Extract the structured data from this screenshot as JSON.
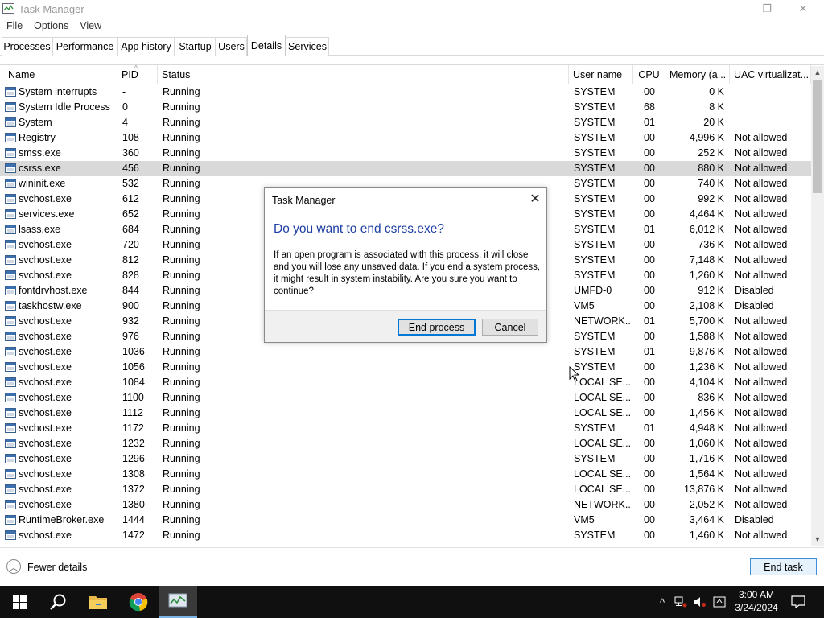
{
  "window": {
    "title": "Task Manager",
    "minimize": "—",
    "restore": "❐",
    "close": "✕"
  },
  "menu": [
    "File",
    "Options",
    "View"
  ],
  "tabs": [
    "Processes",
    "Performance",
    "App history",
    "Startup",
    "Users",
    "Details",
    "Services"
  ],
  "active_tab": "Details",
  "columns": [
    "Name",
    "PID",
    "Status",
    "User name",
    "CPU",
    "Memory (a...",
    "UAC virtualizat..."
  ],
  "rows": [
    {
      "name": "System interrupts",
      "pid": "-",
      "status": "Running",
      "user": "SYSTEM",
      "cpu": "00",
      "mem": "0 K",
      "uac": ""
    },
    {
      "name": "System Idle Process",
      "pid": "0",
      "status": "Running",
      "user": "SYSTEM",
      "cpu": "68",
      "mem": "8 K",
      "uac": ""
    },
    {
      "name": "System",
      "pid": "4",
      "status": "Running",
      "user": "SYSTEM",
      "cpu": "01",
      "mem": "20 K",
      "uac": ""
    },
    {
      "name": "Registry",
      "pid": "108",
      "status": "Running",
      "user": "SYSTEM",
      "cpu": "00",
      "mem": "4,996 K",
      "uac": "Not allowed"
    },
    {
      "name": "smss.exe",
      "pid": "360",
      "status": "Running",
      "user": "SYSTEM",
      "cpu": "00",
      "mem": "252 K",
      "uac": "Not allowed"
    },
    {
      "name": "csrss.exe",
      "pid": "456",
      "status": "Running",
      "user": "SYSTEM",
      "cpu": "00",
      "mem": "880 K",
      "uac": "Not allowed",
      "selected": true
    },
    {
      "name": "wininit.exe",
      "pid": "532",
      "status": "Running",
      "user": "SYSTEM",
      "cpu": "00",
      "mem": "740 K",
      "uac": "Not allowed"
    },
    {
      "name": "svchost.exe",
      "pid": "612",
      "status": "Running",
      "user": "SYSTEM",
      "cpu": "00",
      "mem": "992 K",
      "uac": "Not allowed"
    },
    {
      "name": "services.exe",
      "pid": "652",
      "status": "Running",
      "user": "SYSTEM",
      "cpu": "00",
      "mem": "4,464 K",
      "uac": "Not allowed"
    },
    {
      "name": "lsass.exe",
      "pid": "684",
      "status": "Running",
      "user": "SYSTEM",
      "cpu": "01",
      "mem": "6,012 K",
      "uac": "Not allowed"
    },
    {
      "name": "svchost.exe",
      "pid": "720",
      "status": "Running",
      "user": "SYSTEM",
      "cpu": "00",
      "mem": "736 K",
      "uac": "Not allowed"
    },
    {
      "name": "svchost.exe",
      "pid": "812",
      "status": "Running",
      "user": "SYSTEM",
      "cpu": "00",
      "mem": "7,148 K",
      "uac": "Not allowed"
    },
    {
      "name": "svchost.exe",
      "pid": "828",
      "status": "Running",
      "user": "SYSTEM",
      "cpu": "00",
      "mem": "1,260 K",
      "uac": "Not allowed"
    },
    {
      "name": "fontdrvhost.exe",
      "pid": "844",
      "status": "Running",
      "user": "UMFD-0",
      "cpu": "00",
      "mem": "912 K",
      "uac": "Disabled"
    },
    {
      "name": "taskhostw.exe",
      "pid": "900",
      "status": "Running",
      "user": "VM5",
      "cpu": "00",
      "mem": "2,108 K",
      "uac": "Disabled"
    },
    {
      "name": "svchost.exe",
      "pid": "932",
      "status": "Running",
      "user": "NETWORK...",
      "cpu": "01",
      "mem": "5,700 K",
      "uac": "Not allowed"
    },
    {
      "name": "svchost.exe",
      "pid": "976",
      "status": "Running",
      "user": "SYSTEM",
      "cpu": "00",
      "mem": "1,588 K",
      "uac": "Not allowed"
    },
    {
      "name": "svchost.exe",
      "pid": "1036",
      "status": "Running",
      "user": "SYSTEM",
      "cpu": "01",
      "mem": "9,876 K",
      "uac": "Not allowed"
    },
    {
      "name": "svchost.exe",
      "pid": "1056",
      "status": "Running",
      "user": "SYSTEM",
      "cpu": "00",
      "mem": "1,236 K",
      "uac": "Not allowed"
    },
    {
      "name": "svchost.exe",
      "pid": "1084",
      "status": "Running",
      "user": "LOCAL SE...",
      "cpu": "00",
      "mem": "4,104 K",
      "uac": "Not allowed"
    },
    {
      "name": "svchost.exe",
      "pid": "1100",
      "status": "Running",
      "user": "LOCAL SE...",
      "cpu": "00",
      "mem": "836 K",
      "uac": "Not allowed"
    },
    {
      "name": "svchost.exe",
      "pid": "1112",
      "status": "Running",
      "user": "LOCAL SE...",
      "cpu": "00",
      "mem": "1,456 K",
      "uac": "Not allowed"
    },
    {
      "name": "svchost.exe",
      "pid": "1172",
      "status": "Running",
      "user": "SYSTEM",
      "cpu": "01",
      "mem": "4,948 K",
      "uac": "Not allowed"
    },
    {
      "name": "svchost.exe",
      "pid": "1232",
      "status": "Running",
      "user": "LOCAL SE...",
      "cpu": "00",
      "mem": "1,060 K",
      "uac": "Not allowed"
    },
    {
      "name": "svchost.exe",
      "pid": "1296",
      "status": "Running",
      "user": "SYSTEM",
      "cpu": "00",
      "mem": "1,716 K",
      "uac": "Not allowed"
    },
    {
      "name": "svchost.exe",
      "pid": "1308",
      "status": "Running",
      "user": "LOCAL SE...",
      "cpu": "00",
      "mem": "1,564 K",
      "uac": "Not allowed"
    },
    {
      "name": "svchost.exe",
      "pid": "1372",
      "status": "Running",
      "user": "LOCAL SE...",
      "cpu": "00",
      "mem": "13,876 K",
      "uac": "Not allowed"
    },
    {
      "name": "svchost.exe",
      "pid": "1380",
      "status": "Running",
      "user": "NETWORK...",
      "cpu": "00",
      "mem": "2,052 K",
      "uac": "Not allowed"
    },
    {
      "name": "RuntimeBroker.exe",
      "pid": "1444",
      "status": "Running",
      "user": "VM5",
      "cpu": "00",
      "mem": "3,464 K",
      "uac": "Disabled"
    },
    {
      "name": "svchost.exe",
      "pid": "1472",
      "status": "Running",
      "user": "SYSTEM",
      "cpu": "00",
      "mem": "1,460 K",
      "uac": "Not allowed"
    }
  ],
  "footer": {
    "fewer_details": "Fewer details",
    "end_task": "End task"
  },
  "dialog": {
    "title": "Task Manager",
    "heading": "Do you want to end csrss.exe?",
    "body": "If an open program is associated with this process, it will close and you will lose any unsaved data. If you end a system process, it might result in system instability. Are you sure you want to continue?",
    "confirm": "End process",
    "cancel": "Cancel"
  },
  "taskbar": {
    "time": "3:00 AM",
    "date": "3/24/2024"
  },
  "colors": {
    "accent": "#0078d7",
    "dialog_heading": "#1f3fa3",
    "selected_row": "#d9d9d9",
    "taskbar": "#101010"
  }
}
